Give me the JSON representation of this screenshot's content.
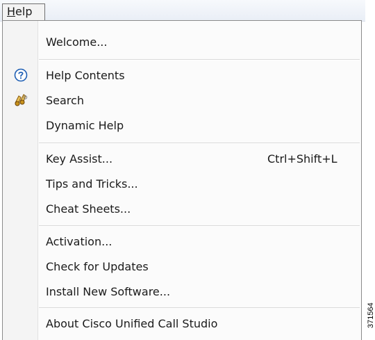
{
  "menubar": {
    "active_menu_mnemonic": "H",
    "active_menu_rest": "elp"
  },
  "menu": {
    "items": [
      {
        "label": "Welcome...",
        "icon": ""
      },
      {
        "label": "Help Contents",
        "icon": "help-circle-icon"
      },
      {
        "label": "Search",
        "icon": "search-binoculars-icon"
      },
      {
        "label": "Dynamic Help",
        "icon": ""
      },
      {
        "label": "Key Assist...",
        "shortcut": "Ctrl+Shift+L",
        "icon": ""
      },
      {
        "label": "Tips and Tricks...",
        "icon": ""
      },
      {
        "label": "Cheat Sheets...",
        "icon": ""
      },
      {
        "label": "Activation...",
        "icon": ""
      },
      {
        "label": "Check for Updates",
        "icon": ""
      },
      {
        "label": "Install New Software...",
        "icon": ""
      },
      {
        "label": "About Cisco Unified Call Studio",
        "icon": ""
      }
    ]
  },
  "figure_id": "371564",
  "colors": {
    "menu_background": "#fbfbfb",
    "gutter_background": "#f4f4f4",
    "menubar_background": "#e9eef6",
    "help_icon_blue": "#1f5fb4",
    "search_icon_gold": "#c8921c"
  }
}
